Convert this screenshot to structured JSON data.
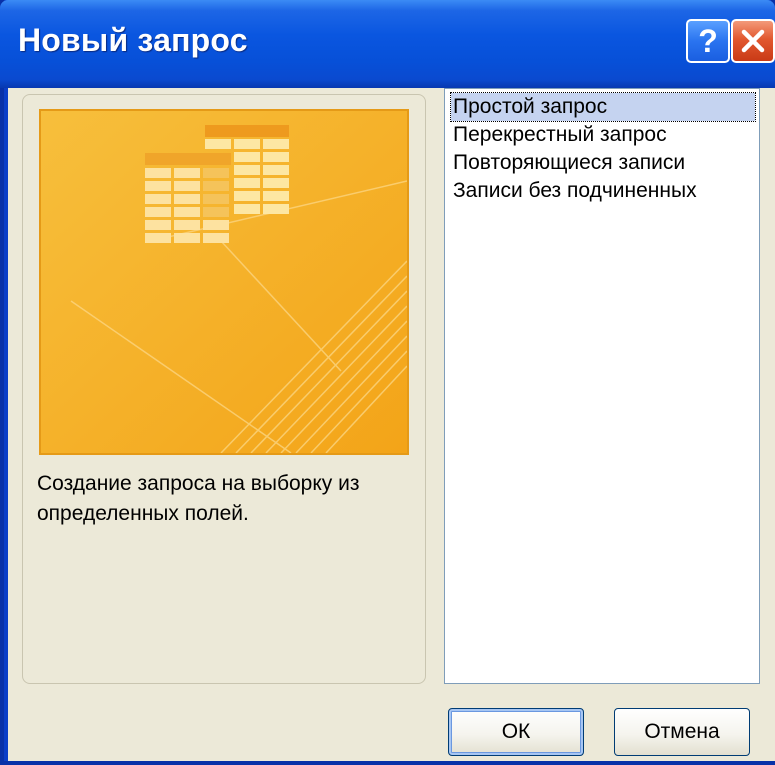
{
  "window": {
    "title": "Новый запрос",
    "help_label": "?",
    "close_icon": "close-icon"
  },
  "preview": {
    "icon": "query-tables-icon",
    "description": "Создание запроса на выборку из определенных полей."
  },
  "query_types": {
    "items": [
      {
        "label": "Простой запрос",
        "selected": true
      },
      {
        "label": "Перекрестный запрос",
        "selected": false
      },
      {
        "label": "Повторяющиеся записи",
        "selected": false
      },
      {
        "label": "Записи без подчиненных",
        "selected": false
      }
    ]
  },
  "buttons": {
    "ok_label": "ОК",
    "cancel_label": "Отмена"
  },
  "colors": {
    "titlebar": "#0a56e0",
    "dialog_bg": "#ece9d8",
    "preview_bg": "#f5b223",
    "selection": "#c5d3f0",
    "close_button": "#e2582f"
  }
}
